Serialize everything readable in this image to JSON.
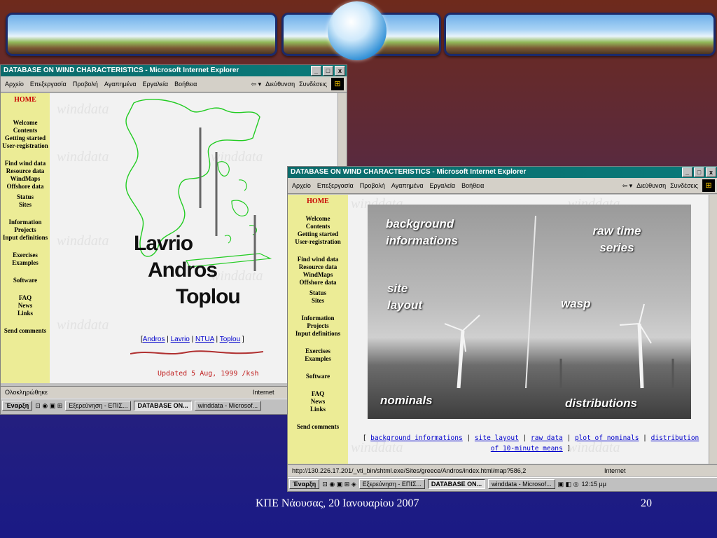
{
  "slide": {
    "footer_text": "ΚΠΕ Νάουσας, 20 Ιανουαρίου 2007",
    "page_number": "20"
  },
  "browser": {
    "title": "DATABASE ON WIND CHARACTERISTICS - Microsoft Internet Explorer",
    "menu": [
      "Αρχείο",
      "Επεξεργασία",
      "Προβολή",
      "Αγαπημένα",
      "Εργαλεία",
      "Βοήθεια"
    ],
    "address_label": "Διεύθυνση",
    "links_label": "Συνδέσεις",
    "window_buttons": [
      "_",
      "□",
      "x"
    ]
  },
  "nav": {
    "home": "HOME",
    "group1": [
      "Welcome",
      "Contents",
      "Getting started",
      "User-registration"
    ],
    "group2": [
      "Find wind data",
      "Resource data",
      "WindMaps",
      "Offshore data",
      "Status",
      "Sites"
    ],
    "group3": [
      "Information",
      "Projects",
      "Input definitions"
    ],
    "group4": [
      "Exercises",
      "Examples"
    ],
    "group5": [
      "Software"
    ],
    "group6": [
      "FAQ",
      "News",
      "Links"
    ],
    "group7": [
      "Send comments"
    ]
  },
  "left_page": {
    "watermark": "winddata",
    "sites": [
      "Lavrio",
      "Andros",
      "Toplou"
    ],
    "links": [
      "Andros",
      "Lavrio",
      "NTUA",
      "Toplou"
    ],
    "updated": "Updated 5 Aug, 1999 /ksh",
    "status": "Ολοκληρώθηκε",
    "zone": "Internet"
  },
  "right_page": {
    "photo_labels": {
      "background": "background informations",
      "raw": "raw time series",
      "site": "site layout",
      "wasp": "wasp",
      "nominals": "nominals",
      "distributions": "distributions"
    },
    "links": [
      "background informations",
      "site layout",
      "raw data",
      "plot of nominals",
      "distribution of 10-minute means"
    ],
    "status_url": "http://130.226.17.201/_vti_bin/shtml.exe/Sites/greece/Andros/index.html/map?586,2",
    "zone": "Internet"
  },
  "taskbar": {
    "start": "Έναρξη",
    "tasks": [
      "Εξερεύνηση - ΕΠΙΣ...",
      "DATABASE ON...",
      "winddata - Microsof..."
    ],
    "clock": "12:15 μμ"
  }
}
